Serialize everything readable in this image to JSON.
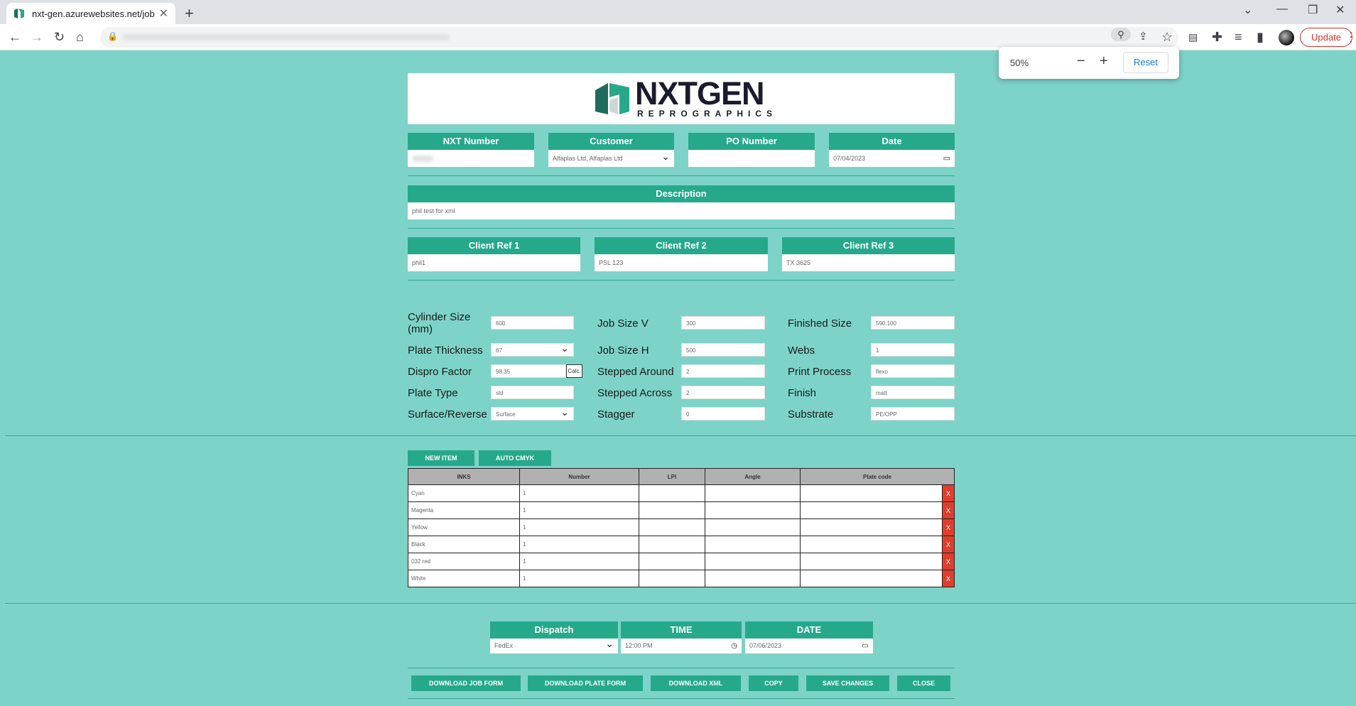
{
  "browser": {
    "tab_title": "nxt-gen.azurewebsites.net/job-d",
    "update_label": "Update",
    "zoom_level": "50%",
    "zoom_reset_label": "Reset"
  },
  "logo": {
    "brand": "NXTGEN",
    "sub": "REPROGRAPHICS"
  },
  "top_fields": {
    "nxt_number": {
      "label": "NXT Number",
      "value": ""
    },
    "customer": {
      "label": "Customer",
      "value": "Alfaplas Ltd, Alfaplas Ltd"
    },
    "po_number": {
      "label": "PO Number",
      "value": ""
    },
    "date": {
      "label": "Date",
      "value": "07/04/2023"
    }
  },
  "description": {
    "label": "Description",
    "value": "phil test for xml"
  },
  "client_refs": [
    {
      "label": "Client Ref 1",
      "value": "phil1"
    },
    {
      "label": "Client Ref 2",
      "value": "PSL 123"
    },
    {
      "label": "Client Ref 3",
      "value": "TX 3625"
    }
  ],
  "specs": {
    "cylinder_size": {
      "label": "Cylinder Size (mm)",
      "value": "600"
    },
    "plate_thickness": {
      "label": "Plate Thickness",
      "value": "67"
    },
    "dispro_factor": {
      "label": "Dispro Factor",
      "value": "98.35",
      "calc_label": "Calc."
    },
    "plate_type": {
      "label": "Plate Type",
      "value": "std"
    },
    "surface_reverse": {
      "label": "Surface/Reverse",
      "value": "Surface"
    },
    "job_size_v": {
      "label": "Job Size V",
      "value": "300"
    },
    "job_size_h": {
      "label": "Job Size H",
      "value": "500"
    },
    "stepped_around": {
      "label": "Stepped Around",
      "value": "2"
    },
    "stepped_across": {
      "label": "Stepped Across",
      "value": "2"
    },
    "stagger": {
      "label": "Stagger",
      "value": "0"
    },
    "finished_size": {
      "label": "Finished Size",
      "value": "590.100"
    },
    "webs": {
      "label": "Webs",
      "value": "1"
    },
    "print_process": {
      "label": "Print Process",
      "value": "flexo"
    },
    "finish": {
      "label": "Finish",
      "value": "matt"
    },
    "substrate": {
      "label": "Substrate",
      "value": "PE/OPP"
    }
  },
  "ink_buttons": {
    "new_item": "NEW ITEM",
    "auto_cmyk": "AUTO CMYK"
  },
  "inks_table": {
    "headers": [
      "INKS",
      "Number",
      "LPI",
      "Angle",
      "Plate code"
    ],
    "delete_label": "X",
    "rows": [
      {
        "ink": "Cyan",
        "number": "1",
        "lpi": "",
        "angle": "",
        "plate_code": ""
      },
      {
        "ink": "Magenta",
        "number": "1",
        "lpi": "",
        "angle": "",
        "plate_code": ""
      },
      {
        "ink": "Yellow",
        "number": "1",
        "lpi": "",
        "angle": "",
        "plate_code": ""
      },
      {
        "ink": "Black",
        "number": "1",
        "lpi": "",
        "angle": "",
        "plate_code": ""
      },
      {
        "ink": "032 red",
        "number": "1",
        "lpi": "",
        "angle": "",
        "plate_code": ""
      },
      {
        "ink": "White",
        "number": "1",
        "lpi": "",
        "angle": "",
        "plate_code": ""
      }
    ]
  },
  "dispatch": {
    "dispatch": {
      "label": "Dispatch",
      "value": "FedEx"
    },
    "time": {
      "label": "TIME",
      "value": "12:00 PM"
    },
    "date": {
      "label": "DATE",
      "value": "07/06/2023"
    }
  },
  "actions": {
    "download_job_form": "DOWNLOAD JOB FORM",
    "download_plate_form": "DOWNLOAD PLATE FORM",
    "download_xml": "DOWNLOAD XML",
    "copy": "COPY",
    "save_changes": "SAVE CHANGES",
    "close": "CLOSE"
  }
}
